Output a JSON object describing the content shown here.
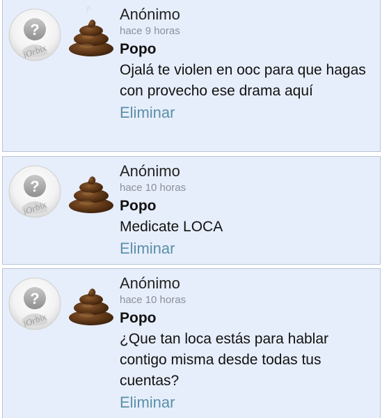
{
  "messages": [
    {
      "author": "Anónimo",
      "time": "hace 9 horas",
      "gift": "Popo",
      "text": "Ojalá te violen en ooc para que hagas con provecho ese drama aquí",
      "delete_label": "Eliminar"
    },
    {
      "author": "Anónimo",
      "time": "hace 10 horas",
      "gift": "Popo",
      "text": "Medicate LOCA",
      "delete_label": "Eliminar"
    },
    {
      "author": "Anónimo",
      "time": "hace 10 horas",
      "gift": "Popo",
      "text": "¿Que tan loca estás para hablar contigo misma desde todas tus cuentas?",
      "delete_label": "Eliminar"
    }
  ],
  "avatar_watermark": "iOrbix",
  "icons": {
    "avatar": "anonymous-avatar-icon",
    "gift": "poop-icon"
  },
  "colors": {
    "card_bg": "#e7eefb",
    "card_border": "#b8c3d6",
    "link": "#5a8fa8",
    "time": "#8a8f99"
  }
}
